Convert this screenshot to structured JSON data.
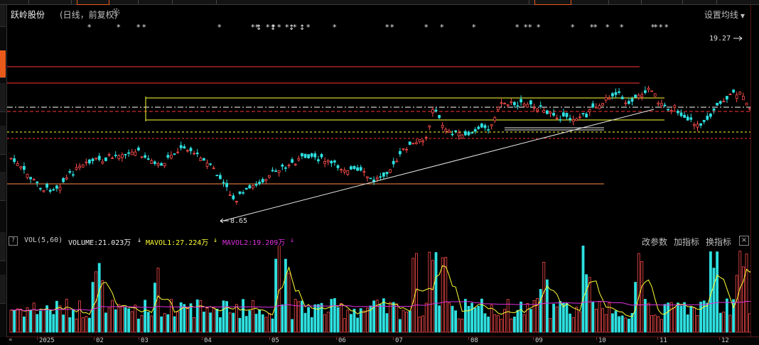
{
  "stock": {
    "name": "跃岭股份",
    "mode": "(日线，前复权)"
  },
  "header": {
    "ma_settings_label": "设置均线"
  },
  "price_labels": {
    "high": "19.27",
    "low": "8.65"
  },
  "volume": {
    "title": "VOL(5,60)",
    "volume_label": "VOLUME:21.023万",
    "ma1_label": "MAVOL1:27.224万",
    "ma2_label": "MAVOL2:19.209万",
    "arrow": "↓",
    "buttons": [
      "改参数",
      "加指标",
      "换指标"
    ]
  },
  "xaxis": {
    "prev_glyph": "«",
    "labels": [
      "2025",
      "02",
      "03",
      "04",
      "05",
      "06",
      "07",
      "08",
      "09",
      "10",
      "11",
      "12"
    ]
  },
  "colors": {
    "up": "#ff4d4d",
    "down": "#2fe0e0",
    "ma1": "#ffff33",
    "ma2": "#e030e0",
    "accent": "#e85a1a"
  },
  "icons": {
    "gear": "gear-icon",
    "help": "help-icon",
    "close": "close-icon"
  }
}
